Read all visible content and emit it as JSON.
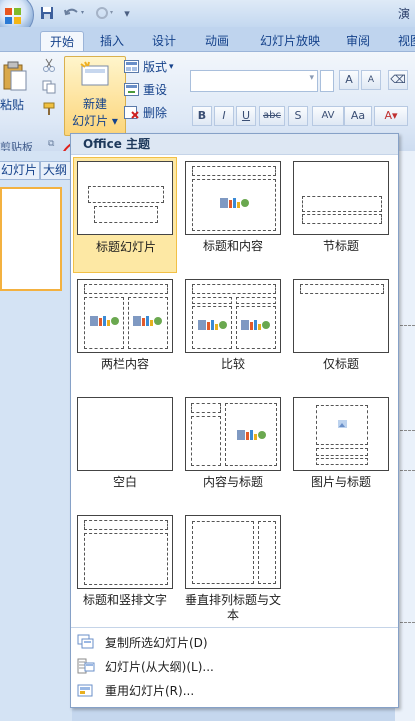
{
  "window": {
    "title_partial": "演"
  },
  "tabs": [
    {
      "label": "开始",
      "active": true
    },
    {
      "label": "插入"
    },
    {
      "label": "设计"
    },
    {
      "label": "动画"
    },
    {
      "label": "幻灯片放映"
    },
    {
      "label": "审阅"
    },
    {
      "label": "视图"
    }
  ],
  "ribbon": {
    "paste_label": "粘贴",
    "clipboard_label": "剪贴板",
    "new_slide_line1": "新建",
    "new_slide_line2": "幻灯片",
    "layout_label": "版式",
    "reset_label": "重设",
    "delete_label": "删除",
    "font_grow": "A",
    "font_shrink": "A",
    "bold": "B",
    "italic": "I",
    "underline": "U",
    "strike": "abc",
    "shadow": "S",
    "spacing": "AV",
    "case": "Aa"
  },
  "left_pane": {
    "tab_slides": "幻灯片",
    "tab_outline": "大纲"
  },
  "dropdown": {
    "header": "Office 主题",
    "layouts": [
      {
        "label": "标题幻灯片",
        "selected": true
      },
      {
        "label": "标题和内容"
      },
      {
        "label": "节标题"
      },
      {
        "label": "两栏内容"
      },
      {
        "label": "比较"
      },
      {
        "label": "仅标题"
      },
      {
        "label": "空白"
      },
      {
        "label": "内容与标题"
      },
      {
        "label": "图片与标题"
      },
      {
        "label": "标题和竖排文字"
      },
      {
        "label": "垂直排列标题与文本"
      }
    ],
    "menu": [
      {
        "label": "复制所选幻灯片(D)",
        "icon": "duplicate-slide-icon"
      },
      {
        "label": "幻灯片(从大纲)(L)...",
        "icon": "slides-from-outline-icon"
      },
      {
        "label": "重用幻灯片(R)...",
        "icon": "reuse-slides-icon"
      }
    ]
  },
  "colors": {
    "highlight_circle": "#e0201b",
    "selected_fill": "#fde8a4",
    "ribbon_text": "#15428b"
  }
}
